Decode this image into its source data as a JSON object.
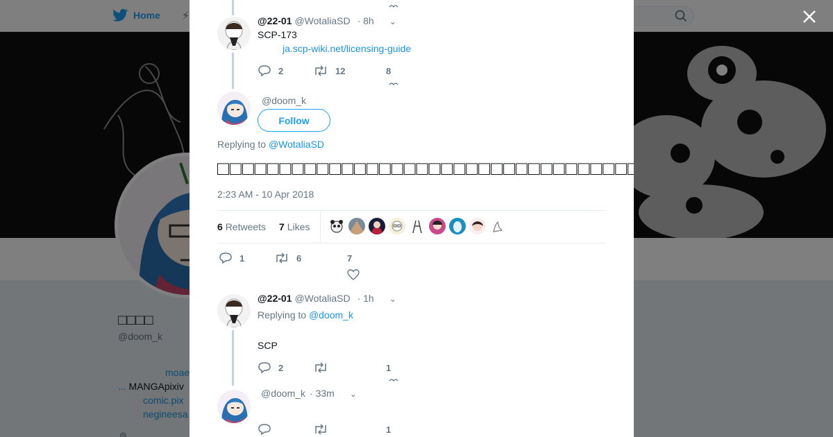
{
  "nav": {
    "home_label": "Home"
  },
  "profile": {
    "display_name": "□□□□",
    "handle": "@doom_k",
    "bio_link1": "moae",
    "bio_line2_dots": "...",
    "bio_line2": " MANGApixiv",
    "bio_link2": "comic.pix",
    "bio_link3": "negineesa"
  },
  "thread": [
    {
      "name": "@22-01",
      "handle": "@WotaliaSD",
      "time": "· 8h",
      "text": "SCP-173",
      "link": "ja.scp-wiki.net/licensing-guide",
      "replies": "2",
      "retweets": "12",
      "likes": "8"
    },
    {
      "handle": "@doom_k",
      "follow_label": "Follow",
      "replying_prefix": "Replying to",
      "replying_to": "@WotaliaSD",
      "text": "□□□□□□□□□□□□□□□□□□□□□□□□□□□□□□□□□□□□□□□□□□□□□□□□□",
      "timestamp": "2:23 AM - 10 Apr 2018",
      "retweet_count": "6",
      "retweet_label": "Retweets",
      "like_count": "7",
      "like_label": "Likes",
      "replies": "1",
      "retweets": "6",
      "likes": "7"
    },
    {
      "name": "@22-01",
      "handle": "@WotaliaSD",
      "time": "· 1h",
      "replying_prefix": "Replying to",
      "replying_to": "@doom_k",
      "text": "SCP",
      "replies": "2",
      "retweets": "",
      "likes": "1"
    },
    {
      "handle": "@doom_k",
      "time": "· 33m",
      "replies": "",
      "retweets": "",
      "likes": "1"
    }
  ],
  "colors": {
    "accent": "#1da1f2",
    "link": "#1b95e0",
    "muted": "#657786"
  }
}
